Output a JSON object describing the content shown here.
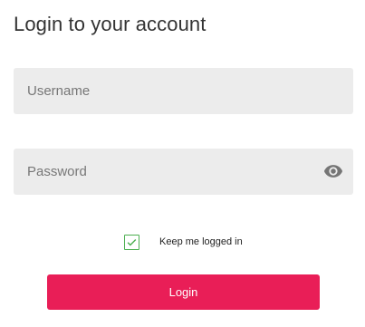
{
  "form": {
    "title": "Login to your account",
    "username": {
      "placeholder": "Username",
      "value": ""
    },
    "password": {
      "placeholder": "Password",
      "value": ""
    },
    "remember": {
      "label": "Keep me logged in",
      "checked": true
    },
    "submit_label": "Login"
  },
  "icons": {
    "password_toggle": "eye-icon",
    "remember_check": "checkmark-icon"
  },
  "colors": {
    "accent": "#e91e57",
    "check": "#4caf50",
    "field_bg": "#ececec"
  }
}
